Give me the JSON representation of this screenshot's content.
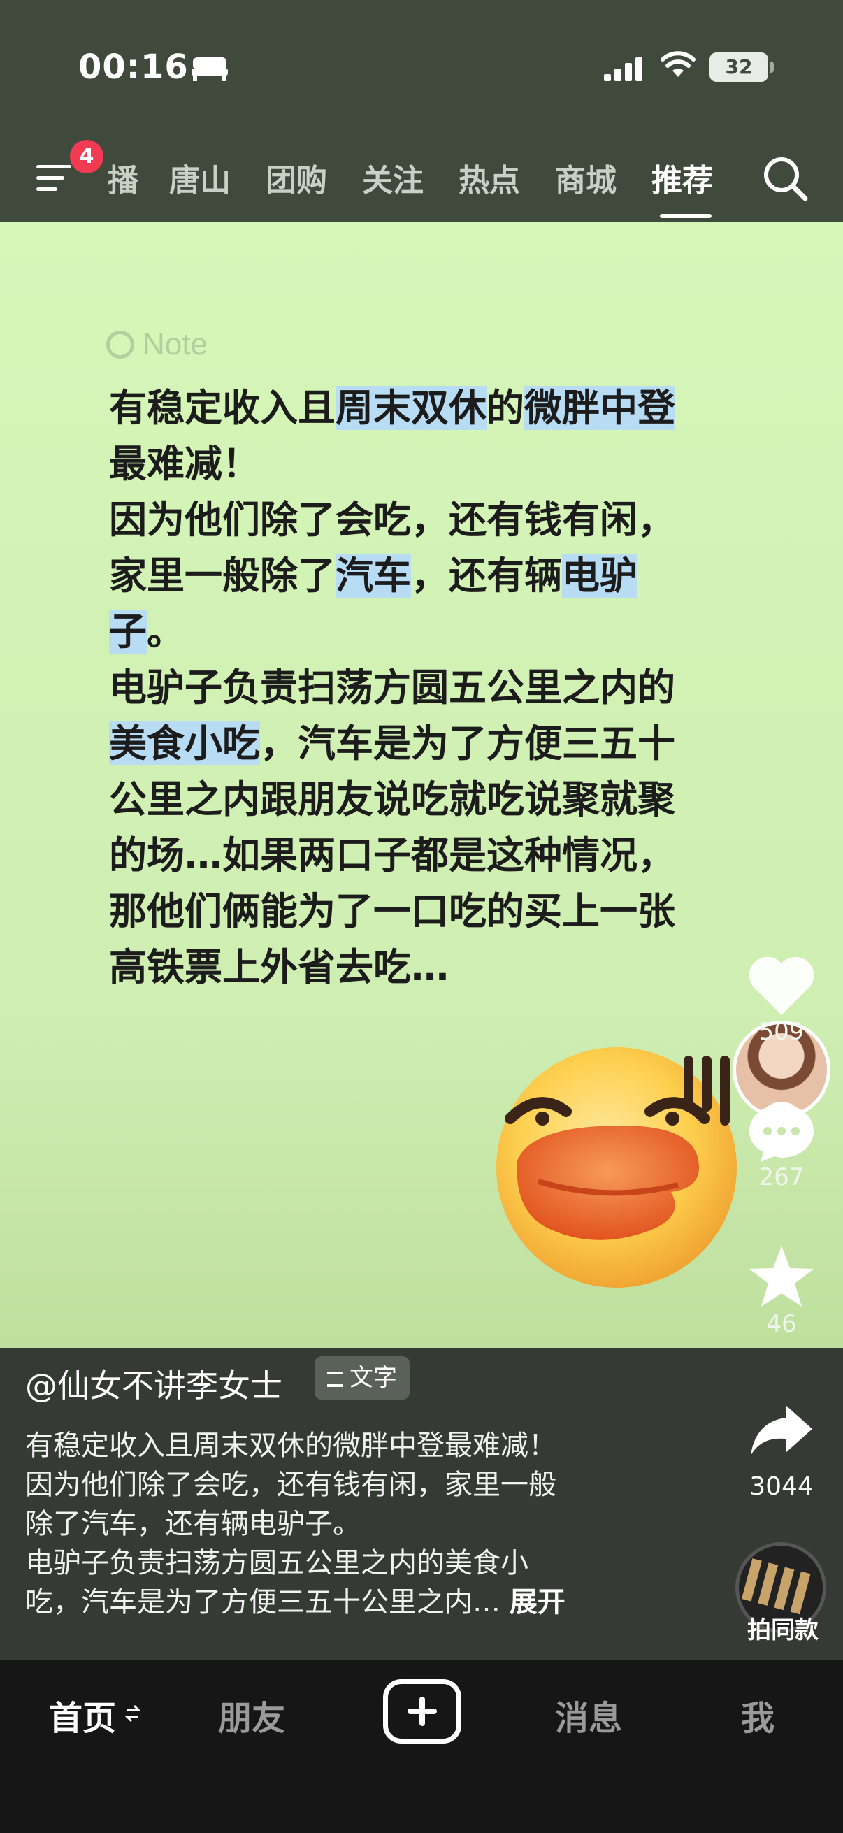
{
  "status_bar": {
    "time": "00:16",
    "battery": "32",
    "icons": [
      "bed-icon",
      "signal-icon",
      "wifi-icon",
      "battery-icon"
    ]
  },
  "top_nav": {
    "menu_badge": "4",
    "tabs": [
      {
        "label": "播",
        "active": false
      },
      {
        "label": "唐山",
        "active": false
      },
      {
        "label": "团购",
        "active": false
      },
      {
        "label": "关注",
        "active": false
      },
      {
        "label": "热点",
        "active": false
      },
      {
        "label": "商城",
        "active": false
      },
      {
        "label": "推荐",
        "active": true
      }
    ]
  },
  "post": {
    "note_tag": "Note",
    "body_lines": [
      "有稳定收入且周末双休的微胖中登",
      "最难减！",
      "因为他们除了会吃，还有钱有闲，",
      "家里一般除了汽车，还有辆电驴",
      "子。",
      "电驴子负责扫荡方圆五公里之内的",
      "美食小吃，汽车是为了方便三五十",
      "公里之内跟朋友说吃就吃说聚就聚",
      "的场…如果两口子都是这种情况，",
      "那他们俩能为了一口吃的买上一张",
      "高铁票上外省去吃…"
    ],
    "highlight_color": "#b7dcf4"
  },
  "actions": {
    "likes": "509",
    "comments": "267",
    "favorites": "46",
    "shares": "3044",
    "same_style_label": "拍同款"
  },
  "info": {
    "author": "@仙女不讲李女士",
    "tag": "文字",
    "description_lines": [
      "有稳定收入且周末双休的微胖中登最难减！",
      "因为他们除了会吃，还有钱有闲，家里一般",
      "除了汽车，还有辆电驴子。",
      "电驴子负责扫荡方圆五公里之内的美食小",
      "吃，汽车是为了方便三五十公里之内… "
    ],
    "expand_label": "展开"
  },
  "bottom_tabs": {
    "home": "首页",
    "friends": "朋友",
    "messages": "消息",
    "me": "我"
  },
  "colors": {
    "accent": "#f23a52",
    "card_bg": "#d5f7b8",
    "header_bg": "#3f4a3d"
  }
}
